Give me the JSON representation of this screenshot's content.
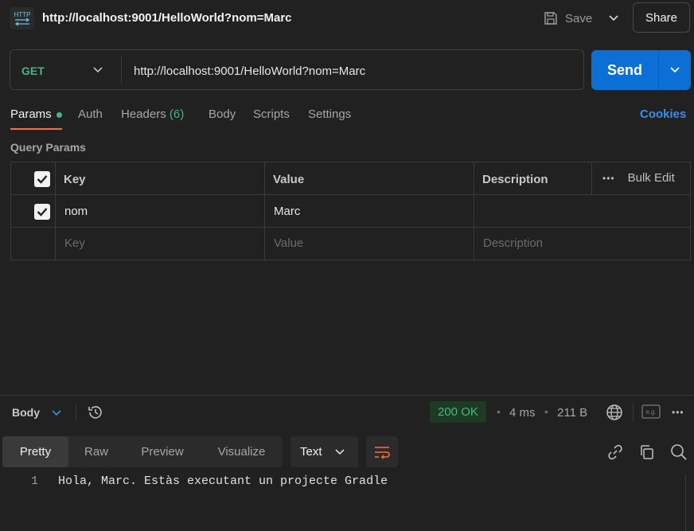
{
  "request": {
    "title": "http://localhost:9001/HelloWorld?nom=Marc",
    "method": "GET",
    "url": "http://localhost:9001/HelloWorld?nom=Marc",
    "badge": "HTTP"
  },
  "toolbar": {
    "save_label": "Save",
    "share_label": "Share",
    "send_label": "Send"
  },
  "tabs": {
    "params": "Params",
    "auth": "Auth",
    "headers": "Headers",
    "headers_count": "(6)",
    "body": "Body",
    "scripts": "Scripts",
    "settings": "Settings",
    "cookies": "Cookies"
  },
  "query_params": {
    "title": "Query Params",
    "columns": {
      "key": "Key",
      "value": "Value",
      "description": "Description",
      "bulk_edit": "Bulk Edit"
    },
    "rows": [
      {
        "key": "nom",
        "value": "Marc",
        "description": "",
        "checked": true
      }
    ],
    "placeholders": {
      "key": "Key",
      "value": "Value",
      "description": "Description"
    }
  },
  "response": {
    "body_label": "Body",
    "status": "200 OK",
    "time": "4 ms",
    "size": "211 B",
    "view_tabs": [
      "Pretty",
      "Raw",
      "Preview",
      "Visualize"
    ],
    "active_view": "Pretty",
    "format": "Text",
    "lines": [
      {
        "number": "1",
        "text": "Hola, Marc. Estàs executant un projecte Gradle"
      }
    ]
  },
  "colors": {
    "accent_orange": "#ff6c37",
    "send_blue": "#0c6fd6",
    "success_green": "#41b883",
    "link_blue": "#3b8fe8"
  }
}
